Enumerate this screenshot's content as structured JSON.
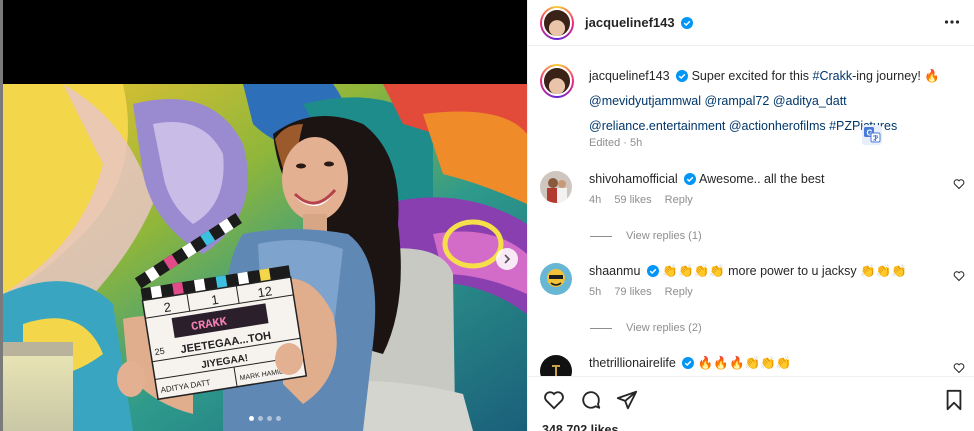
{
  "post": {
    "username": "jacquelinef143",
    "image_alt": "Woman holding a clapperboard reading CRAKK in front of a colorful mural"
  },
  "clapperboard": {
    "title": "CRAKK",
    "line1": "JEETEGAA...TOH",
    "line2": "JIYEGAA!",
    "director": "ADITYA DATT",
    "dop": "MARK HAMILTON",
    "scene": "25",
    "take_a": "2",
    "take_b": "1",
    "take_c": "12"
  },
  "caption": {
    "username": "jacquelinef143",
    "text_prefix": "Super excited for this ",
    "hashtag1": "#Crakk",
    "text_suffix": "-ing journey! 🔥",
    "mention1": "@mevidyutjammwal",
    "mention2": "@rampal72",
    "mention3": "@aditya_datt",
    "mention4": "@reliance.entertainment",
    "mention5": "@actionherofilms",
    "hashtag2": "#PZPictures",
    "meta": "Edited · 5h"
  },
  "comments": [
    {
      "username": "shivohamofficial",
      "text": "Awesome.. all the best",
      "time": "4h",
      "likes": "59 likes",
      "reply": "Reply",
      "view_replies": "View replies (1)"
    },
    {
      "username": "shaanmu",
      "text": "👏👏👏👏 more power to u jacksy 👏👏👏",
      "time": "5h",
      "likes": "79 likes",
      "reply": "Reply",
      "view_replies": "View replies (2)"
    },
    {
      "username": "thetrillionairelife",
      "text": "🔥🔥🔥👏👏👏"
    }
  ],
  "likes_count": "348,702 likes",
  "colors": {
    "link": "#00376b",
    "verified": "#0095f6",
    "muted": "#8e8e8e"
  }
}
